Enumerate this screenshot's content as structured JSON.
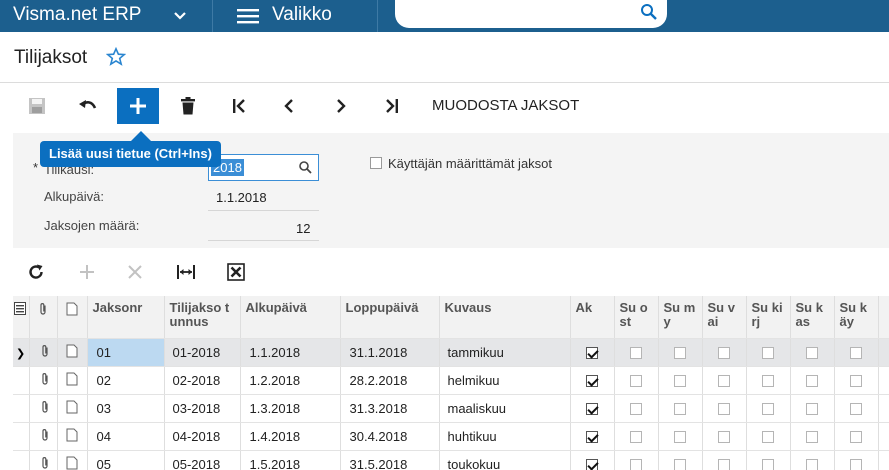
{
  "topbar": {
    "brand": "Visma.net ERP",
    "menu_label": "Valikko",
    "search_value": ""
  },
  "page": {
    "title": "Tilijaksot"
  },
  "toolbar": {
    "generate_label": "MUODOSTA JAKSOT",
    "tooltip": "Lisää uusi tietue (Ctrl+Ins)"
  },
  "form": {
    "required_mark": "*",
    "period_label": "Tilikausi:",
    "period_value": "2018",
    "start_label": "Alkupäivä:",
    "start_value": "1.1.2018",
    "count_label": "Jaksojen määrä:",
    "count_value": "12",
    "custom_label": "Käyttäjän määrittämät jaksot"
  },
  "grid": {
    "columns": [
      "Jaksonr",
      "Tilijakso tunnus",
      "Alkupäivä",
      "Loppupäivä",
      "Kuvaus",
      "Ak",
      "Su ost",
      "Su my",
      "Su vai",
      "Su kirj",
      "Su kas",
      "Su käy"
    ],
    "rows": [
      {
        "nr": "01",
        "id": "01-2018",
        "start": "1.1.2018",
        "end": "31.1.2018",
        "desc": "tammikuu"
      },
      {
        "nr": "02",
        "id": "02-2018",
        "start": "1.2.2018",
        "end": "28.2.2018",
        "desc": "helmikuu"
      },
      {
        "nr": "03",
        "id": "03-2018",
        "start": "1.3.2018",
        "end": "31.3.2018",
        "desc": "maaliskuu"
      },
      {
        "nr": "04",
        "id": "04-2018",
        "start": "1.4.2018",
        "end": "30.4.2018",
        "desc": "huhtikuu"
      },
      {
        "nr": "05",
        "id": "05-2018",
        "start": "1.5.2018",
        "end": "31.5.2018",
        "desc": "toukokuu"
      }
    ]
  },
  "colors": {
    "topbar": "#1c5f8e",
    "accent": "#0b6fc0"
  }
}
